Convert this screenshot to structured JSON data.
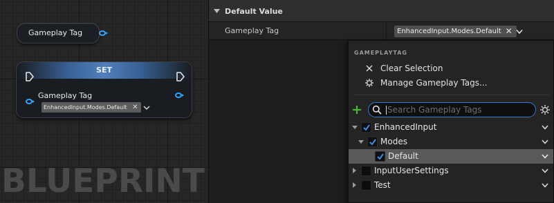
{
  "graph": {
    "watermark": "BLUEPRINT",
    "getter_node": {
      "label": "Gameplay Tag"
    },
    "set_node": {
      "title": "SET",
      "pin_label": "Gameplay Tag",
      "value_chip": "EnhancedInput.Modes.Default",
      "clear_symbol": "✕"
    },
    "pin_color": "#2ea3ff"
  },
  "details": {
    "section_title": "Default Value",
    "property": {
      "name": "Gameplay Tag",
      "value_chip": "EnhancedInput.Modes.Default",
      "clear_symbol": "✕"
    }
  },
  "popup": {
    "category": "GAMEPLAYTAG",
    "menu": [
      {
        "label": "Clear Selection",
        "icon": "close-icon"
      },
      {
        "label": "Manage Gameplay Tags...",
        "icon": "gear-icon"
      }
    ],
    "search": {
      "placeholder": "Search Gameplay Tags",
      "value": ""
    },
    "accent_color": "#2f7bd6",
    "add_color": "#4fb43e",
    "tree": [
      {
        "label": "EnhancedInput",
        "depth": 0,
        "expanded": true,
        "checked": true,
        "has_children": true,
        "selected": false
      },
      {
        "label": "Modes",
        "depth": 1,
        "expanded": true,
        "checked": true,
        "has_children": true,
        "selected": false
      },
      {
        "label": "Default",
        "depth": 2,
        "expanded": false,
        "checked": true,
        "has_children": false,
        "selected": true
      },
      {
        "label": "InputUserSettings",
        "depth": 0,
        "expanded": false,
        "checked": false,
        "has_children": true,
        "selected": false
      },
      {
        "label": "Test",
        "depth": 0,
        "expanded": false,
        "checked": false,
        "has_children": true,
        "selected": false
      }
    ]
  }
}
